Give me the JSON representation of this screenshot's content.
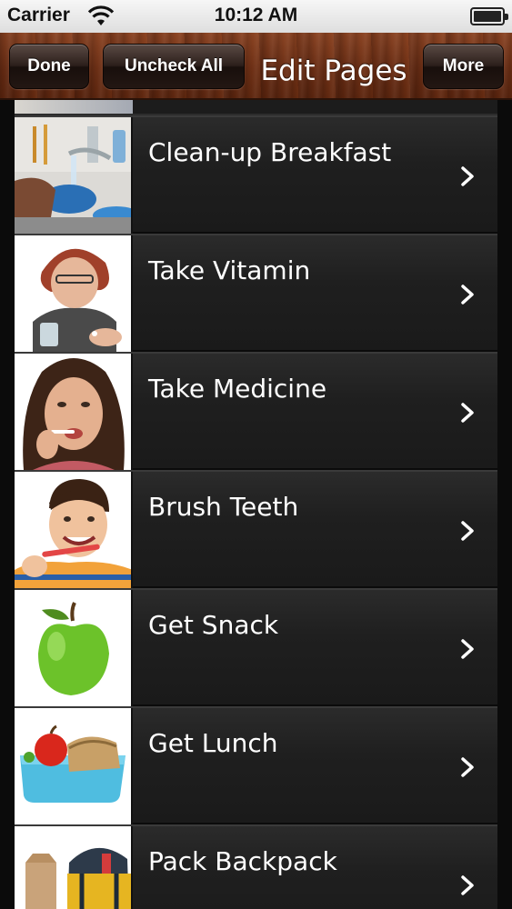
{
  "status_bar": {
    "carrier": "Carrier",
    "time": "10:12 AM",
    "battery_level": 1.0
  },
  "toolbar": {
    "done_label": "Done",
    "uncheck_all_label": "Uncheck All",
    "title": "Edit Pages",
    "more_label": "More"
  },
  "list": {
    "items": [
      {
        "label": "Clean-up Breakfast",
        "icon": "dishwashing-photo"
      },
      {
        "label": "Take Vitamin",
        "icon": "vitamin-photo"
      },
      {
        "label": "Take Medicine",
        "icon": "medicine-photo"
      },
      {
        "label": "Brush Teeth",
        "icon": "toothbrush-photo"
      },
      {
        "label": "Get Snack",
        "icon": "apple-photo"
      },
      {
        "label": "Get Lunch",
        "icon": "lunchbox-photo"
      },
      {
        "label": "Pack Backpack",
        "icon": "backpack-photo"
      }
    ]
  },
  "colors": {
    "toolbar_wood": "#6a2e15",
    "row_background": "#1f1f1f",
    "text": "#ffffff"
  }
}
